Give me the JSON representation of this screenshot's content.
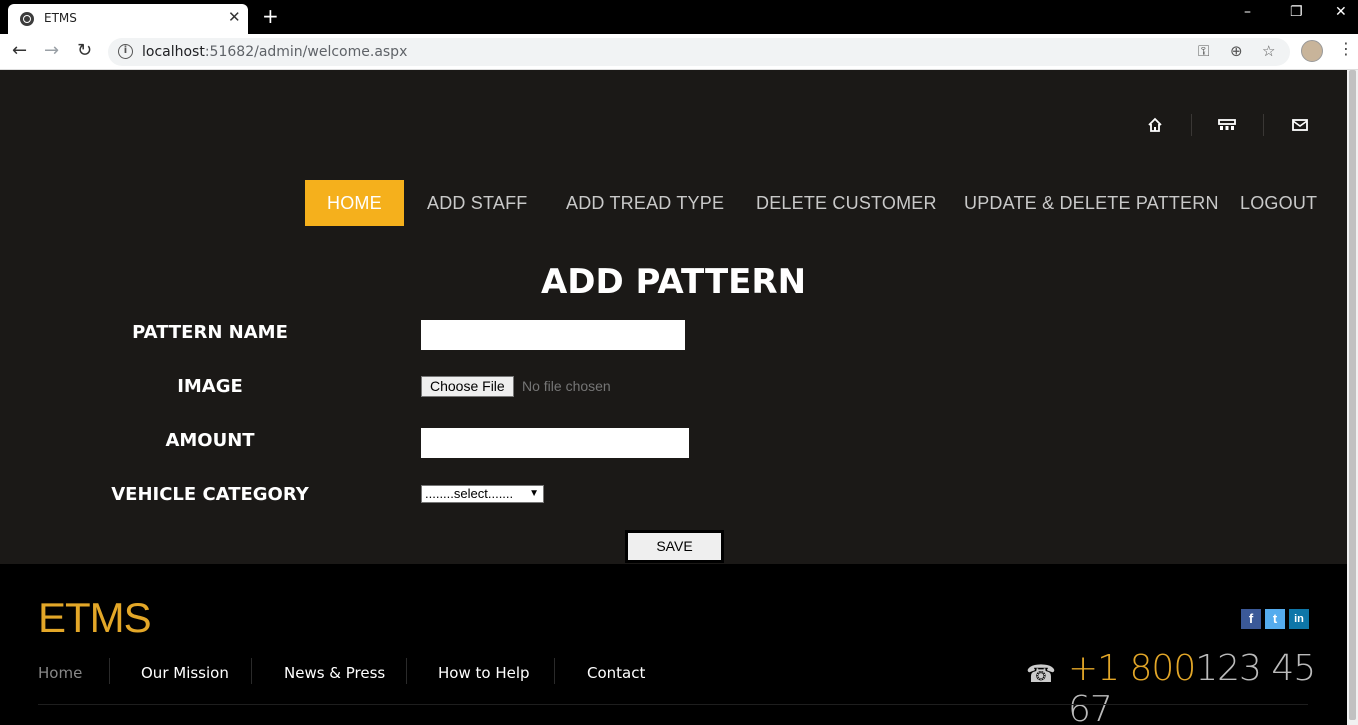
{
  "browser": {
    "tab_title": "ETMS",
    "url_host": "localhost",
    "url_path": ":51682/admin/welcome.aspx",
    "window_minimize": "–",
    "window_restore": "❐",
    "window_close": "✕"
  },
  "header_icons": [
    "home-icon",
    "shop-icon",
    "mail-icon"
  ],
  "nav": {
    "items": [
      {
        "label": "HOME",
        "active": true
      },
      {
        "label": "ADD STAFF"
      },
      {
        "label": "ADD TREAD TYPE"
      },
      {
        "label": "DELETE CUSTOMER"
      },
      {
        "label": "UPDATE & DELETE PATTERN"
      },
      {
        "label": "LOGOUT"
      }
    ]
  },
  "form": {
    "title": "ADD PATTERN",
    "pattern_name_label": "PATTERN NAME",
    "pattern_name_value": "",
    "image_label": "IMAGE",
    "file_button": "Choose File",
    "file_status": "No file chosen",
    "amount_label": "AMOUNT",
    "amount_value": "",
    "vehicle_category_label": "VEHICLE CATEGORY",
    "vehicle_category_selected": "........select.......",
    "save_button": "SAVE"
  },
  "footer": {
    "logo": "ETMS",
    "social": [
      "f",
      "t",
      "in"
    ],
    "links": [
      {
        "label": "Home",
        "active": true
      },
      {
        "label": "Our Mission"
      },
      {
        "label": "News & Press"
      },
      {
        "label": "How to Help"
      },
      {
        "label": "Contact"
      }
    ],
    "phone_prefix": "+1 800",
    "phone_number": "123 45 67"
  },
  "colors": {
    "accent": "#f5b01c",
    "logo_gold": "#e3a728",
    "page_bg": "#1b1917"
  }
}
